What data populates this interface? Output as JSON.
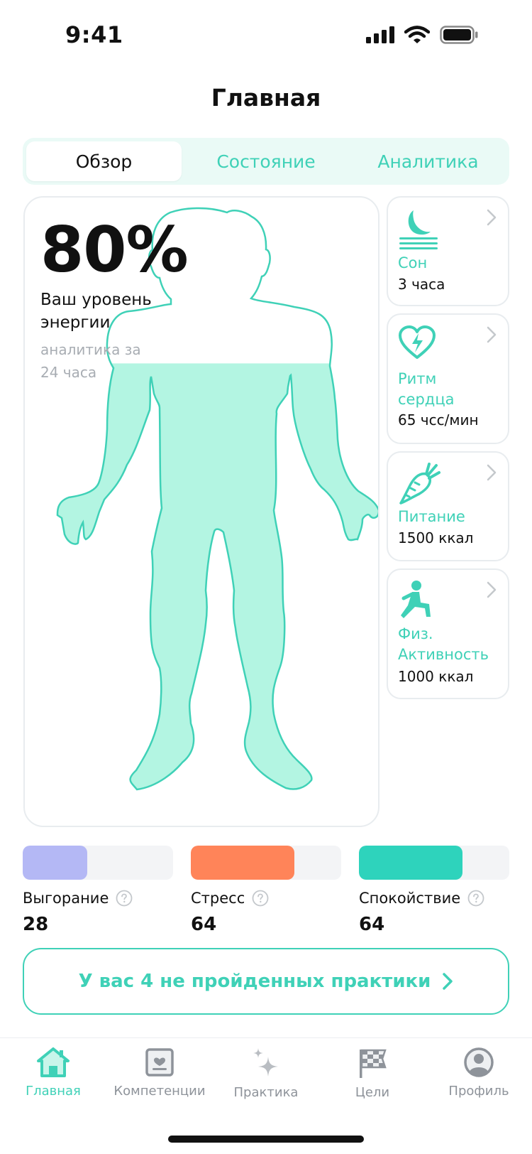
{
  "status_bar": {
    "time": "9:41"
  },
  "page_title": "Главная",
  "tabs": [
    {
      "label": "Обзор",
      "active": true
    },
    {
      "label": "Состояние",
      "active": false
    },
    {
      "label": "Аналитика",
      "active": false
    }
  ],
  "energy": {
    "value": "80%",
    "label": "Ваш уровень энергии",
    "sublabel": "аналитика за 24 часа",
    "fill_fraction": 0.8
  },
  "side_cards": [
    {
      "icon": "moon-icon",
      "label": "Сон",
      "value": "3 часа"
    },
    {
      "icon": "heart-rate-icon",
      "label": "Ритм сердца",
      "value": "65 чсс/мин"
    },
    {
      "icon": "carrot-icon",
      "label": "Питание",
      "value": "1500 ккал"
    },
    {
      "icon": "exercise-icon",
      "label": "Физ. Активность",
      "value": "1000 ккал"
    }
  ],
  "metrics": [
    {
      "label": "Выгорание",
      "value": "28",
      "fill_fraction": 0.43,
      "color": "#b4b8f5"
    },
    {
      "label": "Стресс",
      "value": "64",
      "fill_fraction": 0.69,
      "color": "#ff8459"
    },
    {
      "label": "Спокойствие",
      "value": "64",
      "fill_fraction": 0.69,
      "color": "#2ed3bc"
    }
  ],
  "cta": {
    "text": "У вас 4 не пройденных практики"
  },
  "tabbar": [
    {
      "icon": "home-icon",
      "label": "Главная",
      "active": true
    },
    {
      "icon": "competence-icon",
      "label": "Компетенции",
      "active": false
    },
    {
      "icon": "sparkles-icon",
      "label": "Практика",
      "active": false
    },
    {
      "icon": "checkered-flag-icon",
      "label": "Цели",
      "active": false
    },
    {
      "icon": "profile-icon",
      "label": "Профиль",
      "active": false
    }
  ],
  "colors": {
    "accent": "#3fd1b7",
    "body_fill": "#b3f5e2",
    "text": "#111111"
  }
}
